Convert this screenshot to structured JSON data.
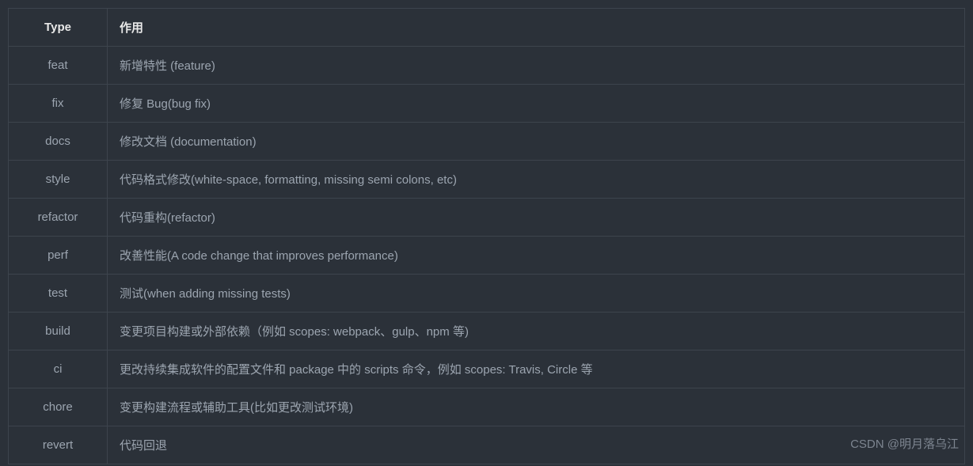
{
  "table": {
    "headers": [
      "Type",
      "作用"
    ],
    "rows": [
      {
        "type": "feat",
        "description": "新增特性 (feature)"
      },
      {
        "type": "fix",
        "description": "修复 Bug(bug fix)"
      },
      {
        "type": "docs",
        "description": "修改文档 (documentation)"
      },
      {
        "type": "style",
        "description": "代码格式修改(white-space, formatting, missing semi colons, etc)"
      },
      {
        "type": "refactor",
        "description": "代码重构(refactor)"
      },
      {
        "type": "perf",
        "description": "改善性能(A code change that improves performance)"
      },
      {
        "type": "test",
        "description": "测试(when adding missing tests)"
      },
      {
        "type": "build",
        "description": "变更项目构建或外部依赖（例如 scopes: webpack、gulp、npm 等)"
      },
      {
        "type": "ci",
        "description": "更改持续集成软件的配置文件和 package 中的 scripts 命令，例如 scopes: Travis, Circle 等"
      },
      {
        "type": "chore",
        "description": "变更构建流程或辅助工具(比如更改测试环境)"
      },
      {
        "type": "revert",
        "description": "代码回退"
      }
    ]
  },
  "watermark": "CSDN @明月落乌江"
}
